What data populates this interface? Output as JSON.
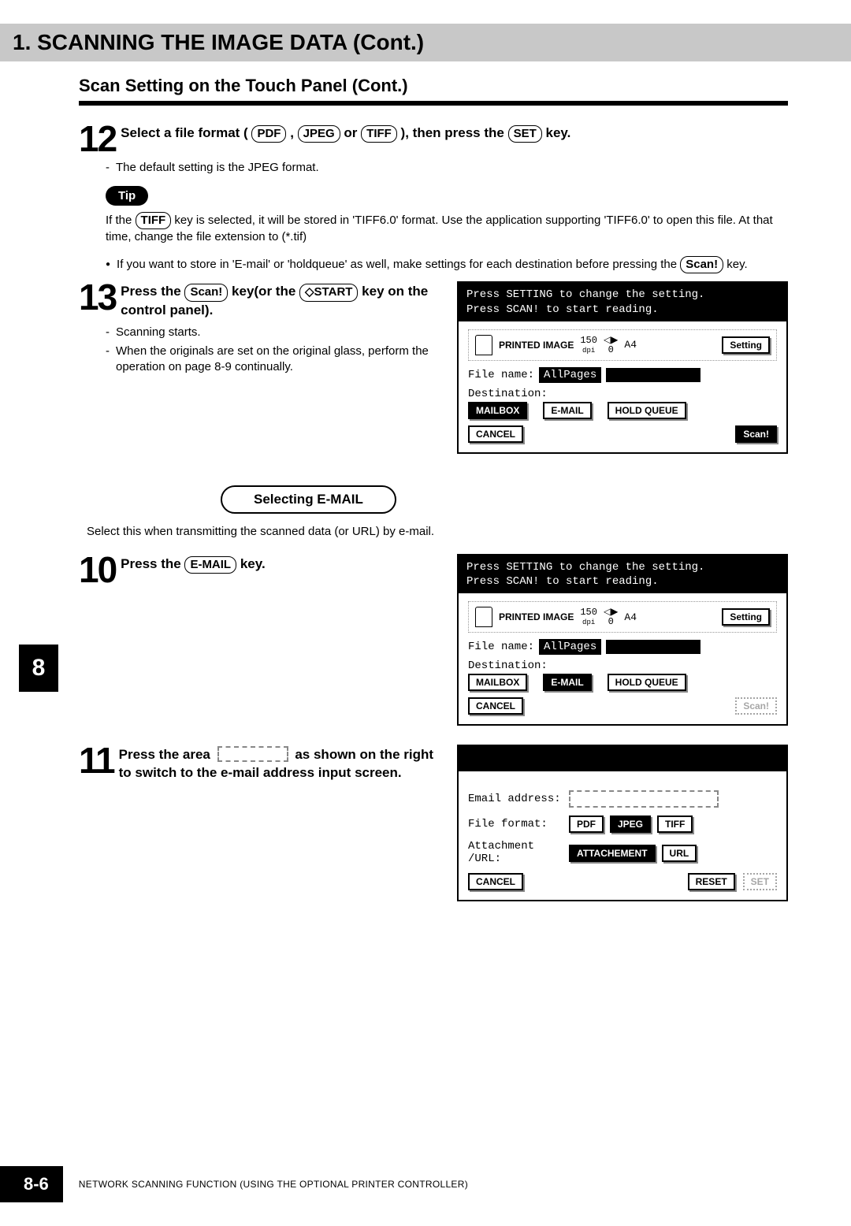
{
  "header": {
    "title": "1. SCANNING THE IMAGE DATA (Cont.)"
  },
  "subtitle": "Scan Setting on the Touch Panel (Cont.)",
  "chapter_tab": "8",
  "step12": {
    "num": "12",
    "line_prefix": "Select a file format (",
    "btn_pdf": "PDF",
    "sep1": " , ",
    "btn_jpeg": "JPEG",
    "sep2": "or ",
    "btn_tiff": "TIFF",
    "line_mid": " ), then press the ",
    "btn_set": "SET",
    "line_suffix": " key.",
    "dash1": "The default setting is the JPEG format."
  },
  "tip": {
    "badge": "Tip",
    "text_prefix": "If the ",
    "btn_tiff": "TIFF",
    "text_body": " key is selected, it will be stored in 'TIFF6.0' format. Use the application supporting 'TIFF6.0' to open this file. At that time, change the file extension to (*.tif)"
  },
  "bullet1": {
    "prefix": "If you want to store in 'E-mail' or 'holdqueue' as well, make settings for each destination before pressing the ",
    "btn_scan": "Scan!",
    "suffix": " key."
  },
  "step13": {
    "num": "13",
    "prefix": "Press the ",
    "btn_scan": "Scan!",
    "mid": " key(or the ",
    "btn_start": "◇START",
    "suffix": " key on the control panel).",
    "dash1": "Scanning starts.",
    "dash2": "When the originals are set on the original glass, perform the operation on page 8-9 continually."
  },
  "panel1": {
    "hdr1": "Press SETTING to change the setting.",
    "hdr2": "Press SCAN! to start reading.",
    "printed_label": "PRINTED IMAGE",
    "dpi_num": "150",
    "dpi_unit": "dpi",
    "zero": "0",
    "size": "A4",
    "setting": "Setting",
    "fname_label": "File name:",
    "fname_value": "AllPages",
    "dest_label": "Destination:",
    "mailbox": "MAILBOX",
    "email": "E-MAIL",
    "holdqueue": "HOLD QUEUE",
    "cancel": "CANCEL",
    "scan": "Scan!"
  },
  "section_email": {
    "title": "Selecting E-MAIL",
    "desc": "Select this when transmitting the scanned data (or URL) by e-mail."
  },
  "step10": {
    "num": "10",
    "prefix": "Press the ",
    "btn_email": "E-MAIL",
    "suffix": " key."
  },
  "panel2": {
    "hdr1": "Press SETTING to change the setting.",
    "hdr2": "Press SCAN! to start reading.",
    "printed_label": "PRINTED IMAGE",
    "dpi_num": "150",
    "dpi_unit": "dpi",
    "zero": "0",
    "size": "A4",
    "setting": "Setting",
    "fname_label": "File name:",
    "fname_value": "AllPages",
    "dest_label": "Destination:",
    "mailbox": "MAILBOX",
    "email": "E-MAIL",
    "holdqueue": "HOLD QUEUE",
    "cancel": "CANCEL",
    "scan": "Scan!"
  },
  "step11": {
    "num": "11",
    "prefix": "Press the area ",
    "suffix": " as shown on the right to switch to the e-mail address input screen."
  },
  "panel3": {
    "email_label": "Email address:",
    "format_label": "File format:",
    "pdf": "PDF",
    "jpeg": "JPEG",
    "tiff": "TIFF",
    "attach_label": "Attachment /URL:",
    "attachment": "ATTACHEMENT",
    "url": "URL",
    "cancel": "CANCEL",
    "reset": "RESET",
    "set": "SET"
  },
  "footer": {
    "page": "8-6",
    "text": "NETWORK SCANNING FUNCTION (USING THE OPTIONAL PRINTER CONTROLLER)"
  }
}
